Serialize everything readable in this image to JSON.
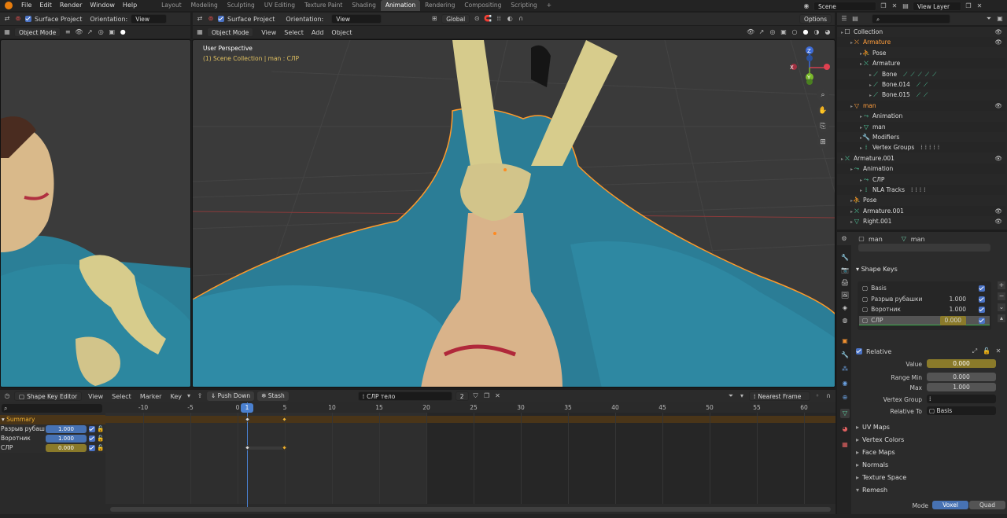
{
  "topbar": {
    "menus": [
      "File",
      "Edit",
      "Render",
      "Window",
      "Help"
    ],
    "workspaces": [
      "Layout",
      "Modeling",
      "Sculpting",
      "UV Editing",
      "Texture Paint",
      "Shading",
      "Animation",
      "Rendering",
      "Compositing",
      "Scripting",
      "+"
    ],
    "active_workspace": "Animation",
    "scene": "Scene",
    "view_layer": "View Layer"
  },
  "left_header": {
    "surface_project": "Surface Project",
    "orientation_label": "Orientation:",
    "orientation": "View",
    "mode": "Object Mode"
  },
  "main_header": {
    "surface_project": "Surface Project",
    "orientation_label": "Orientation:",
    "orientation": "View",
    "transform": "Global",
    "options": "Options",
    "mode": "Object Mode",
    "menus": [
      "View",
      "Select",
      "Add",
      "Object"
    ]
  },
  "viewport": {
    "perspective": "User Perspective",
    "collection": "(1) Scene Collection | man : СЛР"
  },
  "gizmo": {
    "x": "X",
    "y": "Y",
    "z": "Z"
  },
  "outliner": {
    "rows": [
      {
        "label": "Collection",
        "indent": 0,
        "icon": "collection"
      },
      {
        "label": "Armature",
        "indent": 1,
        "icon": "armature",
        "color": "orange"
      },
      {
        "label": "Pose",
        "indent": 2,
        "icon": "pose"
      },
      {
        "label": "Armature",
        "indent": 2,
        "icon": "armature"
      },
      {
        "label": "Bone",
        "indent": 3,
        "icon": "bone"
      },
      {
        "label": "Bone.014",
        "indent": 3,
        "icon": "bone"
      },
      {
        "label": "Bone.015",
        "indent": 3,
        "icon": "bone"
      },
      {
        "label": "man",
        "indent": 1,
        "icon": "mesh",
        "color": "orange"
      },
      {
        "label": "Animation",
        "indent": 2,
        "icon": "anim"
      },
      {
        "label": "man",
        "indent": 2,
        "icon": "mesh"
      },
      {
        "label": "Modifiers",
        "indent": 2,
        "icon": "wrench"
      },
      {
        "label": "Vertex Groups",
        "indent": 2,
        "icon": "vgroup"
      },
      {
        "label": "Armature.001",
        "indent": 0,
        "icon": "armature"
      },
      {
        "label": "Animation",
        "indent": 1,
        "icon": "anim"
      },
      {
        "label": "СЛР",
        "indent": 2,
        "icon": "action"
      },
      {
        "label": "NLA Tracks",
        "indent": 2,
        "icon": "nla"
      },
      {
        "label": "Pose",
        "indent": 1,
        "icon": "pose"
      },
      {
        "label": "Armature.001",
        "indent": 1,
        "icon": "armature"
      },
      {
        "label": "Right.001",
        "indent": 1,
        "icon": "mesh"
      }
    ]
  },
  "properties": {
    "object": "man",
    "data": "man",
    "shape_keys_title": "Shape Keys",
    "keys": [
      {
        "name": "Basis",
        "value": ""
      },
      {
        "name": "Разрыв рубашки",
        "value": "1.000"
      },
      {
        "name": "Воротник",
        "value": "1.000"
      },
      {
        "name": "СЛР",
        "value": "0.000"
      }
    ],
    "relative": "Relative",
    "value_label": "Value",
    "value": "0.000",
    "range_min_label": "Range Min",
    "range_min": "0.000",
    "max_label": "Max",
    "max": "1.000",
    "vertex_group_label": "Vertex Group",
    "relative_to_label": "Relative To",
    "relative_to": "Basis",
    "sections": [
      "UV Maps",
      "Vertex Colors",
      "Face Maps",
      "Normals",
      "Texture Space",
      "Remesh"
    ],
    "mode_label": "Mode",
    "mode_voxel": "Voxel",
    "mode_quad": "Quad"
  },
  "timeline": {
    "editor": "Shape Key Editor",
    "menus": [
      "View",
      "Select",
      "Marker",
      "Key"
    ],
    "push_down": "Push Down",
    "stash": "Stash",
    "action": "СЛР тело",
    "users": "2",
    "snap": "Nearest Frame",
    "current_frame": "1",
    "ticks": [
      "-10",
      "-5",
      "0",
      "5",
      "10",
      "15",
      "20",
      "25",
      "30",
      "35",
      "40",
      "45",
      "50",
      "55",
      "60"
    ],
    "channels": [
      {
        "name": "Summary"
      },
      {
        "name": "Разрыв рубашки",
        "value": "1.000"
      },
      {
        "name": "Воротник",
        "value": "1.000"
      },
      {
        "name": "СЛР",
        "value": "0.000"
      }
    ]
  }
}
